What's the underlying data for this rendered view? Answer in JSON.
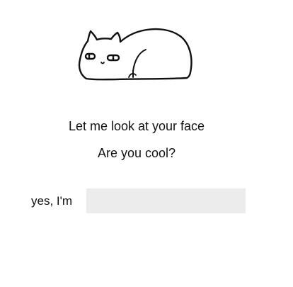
{
  "illustration": {
    "icon": "sleeping-cat-icon"
  },
  "headings": {
    "primary": "Let me look at your face",
    "secondary": "Are you cool?"
  },
  "form": {
    "label": "yes, I'm",
    "input_value": "",
    "input_placeholder": "",
    "input_background": "#ececec"
  }
}
